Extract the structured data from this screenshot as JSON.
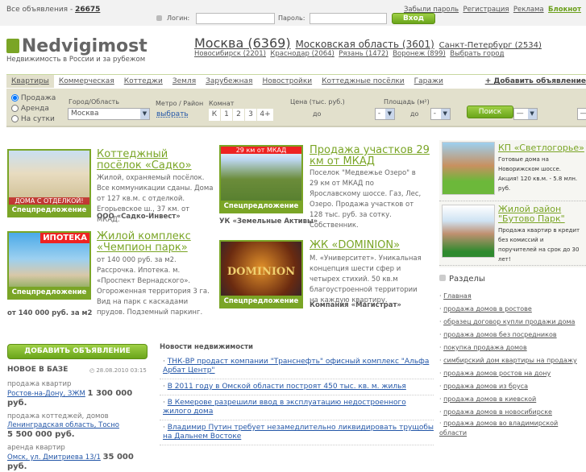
{
  "topbar": {
    "all_ads_label": "Все объявления - ",
    "all_ads_count": "26675",
    "login_label": "Логин:",
    "password_label": "Пароль:",
    "login_button": "Вход",
    "links": [
      "Забыли пароль",
      "Регистрация",
      "Реклама",
      "Блокнот"
    ]
  },
  "logo": {
    "name": "Nedvigimost",
    "tagline": "Недвижимость в России и за рубежом"
  },
  "cities": {
    "main": [
      {
        "label": "Москва (6369)"
      },
      {
        "label": "Московская область (3601)"
      },
      {
        "label": "Санкт-Петербург (2534)"
      }
    ],
    "secondary": [
      "Новосибирск (2201)",
      "Краснодар (2064)",
      "Рязань (1472)",
      "Воронеж (899)",
      "Выбрать город"
    ]
  },
  "tabs": [
    "Квартиры",
    "Коммерческая",
    "Коттеджи",
    "Земля",
    "Зарубежная",
    "Новостройки",
    "Коттеджные посёлки",
    "Гаражи"
  ],
  "add_ad_link": "+ Добавить объявление",
  "search": {
    "deal_types": [
      "Продажа",
      "Аренда",
      "На сутки"
    ],
    "city_label": "Город/Область",
    "city_value": "Москва",
    "metro_label": "Метро / Район",
    "metro_link": "выбрать",
    "rooms_label": "Комнат",
    "rooms": [
      "К",
      "1",
      "2",
      "3",
      "4+"
    ],
    "price_label": "Цена (тыс. руб.)",
    "price_from": "-",
    "price_to": "-",
    "to_label": "до",
    "area_label": "Площадь (м²)",
    "area_from": "—",
    "area_to": "—",
    "search_button": "Поиск"
  },
  "promos": [
    {
      "title": "Коттеджный посёлок «Садко»",
      "desc": "Жилой, охраняемый посёлок. Все коммуникации сданы. Дома от 127 кв.м. с отделкой. Егорьевское ш., 37 км. от МКАД.",
      "footer": "ООО «Садко-Инвест»",
      "banner": "ДОМА С ОТДЕЛКОЙ!",
      "label": "Спецпредложение"
    },
    {
      "title": "Продажа участков 29 км от МКАД",
      "desc": "Поселок \"Медвежье Озеро\" в 29 км от МКАД по Ярославскому шоссе. Газ, Лес, Озеро. Продажа участков от 128 тыс. руб. за сотку. Собственник.",
      "footer": "УК «Земельные Активы»",
      "banner": "29 км от МКАД",
      "label": "Спецпредложение"
    },
    {
      "title": "Жилой комплекс «Чемпион парк»",
      "desc": "от 140 000 руб. за м2. Рассрочка. Ипотека. м. «Проспект Вернадского». Огороженная территория 3 га. Вид на парк с каскадами прудов. Подземный паркинг.",
      "footer": "от 140 000 руб. за м2",
      "banner": "ИПОТЕКА",
      "label": "Спецпредложение"
    },
    {
      "title": "ЖК «DOMINION»",
      "desc": "М. «Университет». Уникальная концепция шести сфер и четырех стихий. 50 кв.м благоустроенной территории на каждую квартиру.",
      "footer": "Компания «Магистрат»",
      "banner": "DOMINION",
      "label": "Спецпредложение"
    }
  ],
  "side_promos": [
    {
      "title": "КП «Светлогорье»",
      "desc": "Готовые дома на Новорижском шоссе. Акция! 120 кв.м. - 5.8 млн. руб."
    },
    {
      "title": "Жилой район \"Бутово Парк\"",
      "desc": "Продажа квартир в кредит без комиссий и поручителей на срок до 30 лет!"
    }
  ],
  "sections": {
    "title": "Разделы",
    "items": [
      "Главная",
      "продажа домов в ростове",
      "образец договор купли продажи дома",
      "продажа домов без посредников",
      "покупка продажа домов",
      "симбирский дом квартиры на продажу",
      "продажа домов ростов на дону",
      "продажа домов из бруса",
      "продажа домов в киевской",
      "продажа домов в новосибирске",
      "продажа домов во владимирской области"
    ]
  },
  "add_button": "ДОБАВИТЬ ОБЪЯВЛЕНИЕ",
  "new_in_db": {
    "title": "НОВОЕ В БАЗЕ",
    "timestamp": "28.08.2010 03:15",
    "items": [
      {
        "category": "продажа квартир",
        "location": "Ростов-на-Дону, ЗЖМ",
        "price": "1 300 000 руб."
      },
      {
        "category": "продажа коттеджей, домов",
        "location": "Ленинградская область, Тосно",
        "price": "5 500 000 руб."
      },
      {
        "category": "аренда квартир",
        "location": "Омск, ул. Дмитриева 13/1",
        "price": "35 000 руб."
      }
    ]
  },
  "news": {
    "title": "Новости недвижимости",
    "items": [
      "ТНК-BP продаст компании \"Транснефть\" офисный комплекс \"Альфа Арбат Центр\"",
      "В 2011 году в Омской области построят 450 тыс. кв. м. жилья",
      "В Кемерове разрешили ввод в эксплуатацию недостроенного жилого дома",
      "Владимир Путин требует незамедлительно ликвидировать трущобы на Дальнем Востоке"
    ]
  },
  "colors": {
    "accent": "#7aa526",
    "news_link": "#2457a8",
    "panel": "#e2e0cc"
  }
}
